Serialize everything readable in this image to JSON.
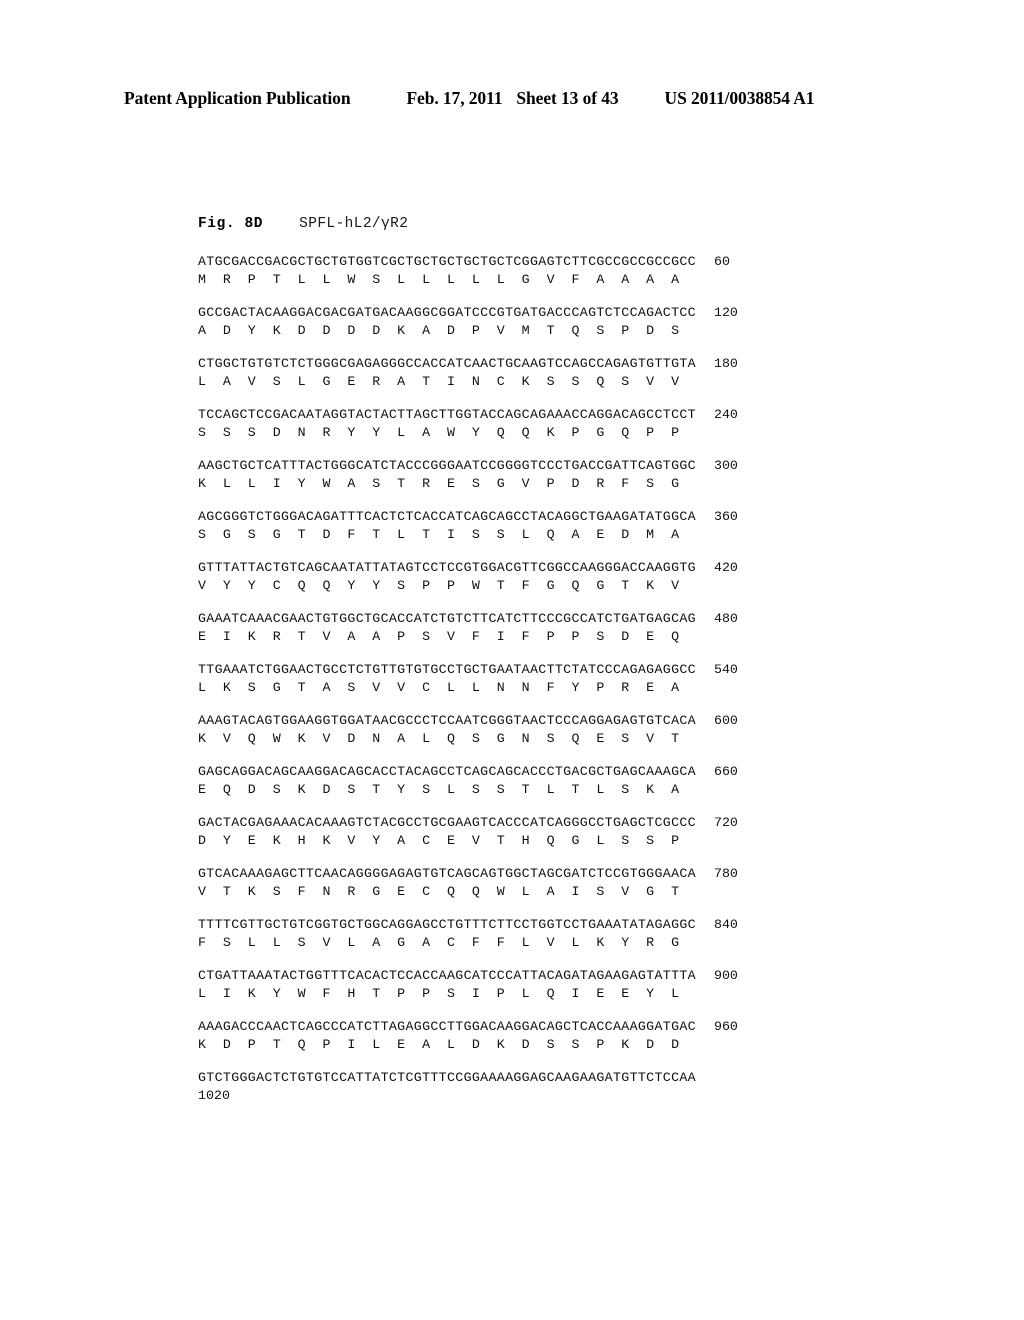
{
  "header": {
    "publication_type": "Patent Application Publication",
    "date": "Feb. 17, 2011",
    "sheet": "Sheet 13 of 43",
    "publication_number": "US 2011/0038854 A1"
  },
  "figure": {
    "label": "Fig. 8D",
    "name": "SPFL-hL2/γR2"
  },
  "sequence": {
    "final_position": "1020",
    "blocks": [
      {
        "nucleotides": "ATGCGACCGACGCTGCTGTGGTCGCTGCTGCTGCTGCTCGGAGTCTTCGCCGCCGCCGCC",
        "end_position": "60",
        "amino_acids": "M  R  P  T  L  L  W  S  L  L  L  L  L  G  V  F  A  A  A  A"
      },
      {
        "nucleotides": "GCCGACTACAAGGACGACGATGACAAGGCGGATCCCGTGATGACCCAGTCTCCAGACTCC",
        "end_position": "120",
        "amino_acids": "A  D  Y  K  D  D  D  D  K  A  D  P  V  M  T  Q  S  P  D  S"
      },
      {
        "nucleotides": "CTGGCTGTGTCTCTGGGCGAGAGGGCCACCATCAACTGCAAGTCCAGCCAGAGTGTTGTA",
        "end_position": "180",
        "amino_acids": "L  A  V  S  L  G  E  R  A  T  I  N  C  K  S  S  Q  S  V  V"
      },
      {
        "nucleotides": "TCCAGCTCCGACAATAGGTACTACTTAGCTTGGTACCAGCAGAAACCAGGACAGCCTCCT",
        "end_position": "240",
        "amino_acids": "S  S  S  D  N  R  Y  Y  L  A  W  Y  Q  Q  K  P  G  Q  P  P"
      },
      {
        "nucleotides": "AAGCTGCTCATTTACTGGGCATCTACCCGGGAATCCGGGGTCCCTGACCGATTCAGTGGC",
        "end_position": "300",
        "amino_acids": "K  L  L  I  Y  W  A  S  T  R  E  S  G  V  P  D  R  F  S  G"
      },
      {
        "nucleotides": "AGCGGGTCTGGGACAGATTTCACTCTCACCATCAGCAGCCTACAGGCTGAAGATATGGCA",
        "end_position": "360",
        "amino_acids": "S  G  S  G  T  D  F  T  L  T  I  S  S  L  Q  A  E  D  M  A"
      },
      {
        "nucleotides": "GTTTATTACTGTCAGCAATATTATAGTCCTCCGTGGACGTTCGGCCAAGGGACCAAGGTG",
        "end_position": "420",
        "amino_acids": "V  Y  Y  C  Q  Q  Y  Y  S  P  P  W  T  F  G  Q  G  T  K  V"
      },
      {
        "nucleotides": "GAAATCAAACGAACTGTGGCTGCACCATCTGTCTTCATCTTCCCGCCATCTGATGAGCAG",
        "end_position": "480",
        "amino_acids": "E  I  K  R  T  V  A  A  P  S  V  F  I  F  P  P  S  D  E  Q"
      },
      {
        "nucleotides": "TTGAAATCTGGAACTGCCTCTGTTGTGTGCCTGCTGAATAACTTCTATCCCAGAGAGGCC",
        "end_position": "540",
        "amino_acids": "L  K  S  G  T  A  S  V  V  C  L  L  N  N  F  Y  P  R  E  A"
      },
      {
        "nucleotides": "AAAGTACAGTGGAAGGTGGATAACGCCCTCCAATCGGGTAACTCCCAGGAGAGTGTCACA",
        "end_position": "600",
        "amino_acids": "K  V  Q  W  K  V  D  N  A  L  Q  S  G  N  S  Q  E  S  V  T"
      },
      {
        "nucleotides": "GAGCAGGACAGCAAGGACAGCACCTACAGCCTCAGCAGCACCCTGACGCTGAGCAAAGCA",
        "end_position": "660",
        "amino_acids": "E  Q  D  S  K  D  S  T  Y  S  L  S  S  T  L  T  L  S  K  A"
      },
      {
        "nucleotides": "GACTACGAGAAACACAAAGTCTACGCCTGCGAAGTCACCCATCAGGGCCTGAGCTCGCCC",
        "end_position": "720",
        "amino_acids": "D  Y  E  K  H  K  V  Y  A  C  E  V  T  H  Q  G  L  S  S  P"
      },
      {
        "nucleotides": "GTCACAAAGAGCTTCAACAGGGGAGAGTGTCAGCAGTGGCTAGCGATCTCCGTGGGAACA",
        "end_position": "780",
        "amino_acids": "V  T  K  S  F  N  R  G  E  C  Q  Q  W  L  A  I  S  V  G  T"
      },
      {
        "nucleotides": "TTTTCGTTGCTGTCGGTGCTGGCAGGAGCCTGTTTCTTCCTGGTCCTGAAATATAGAGGC",
        "end_position": "840",
        "amino_acids": "F  S  L  L  S  V  L  A  G  A  C  F  F  L  V  L  K  Y  R  G"
      },
      {
        "nucleotides": "CTGATTAAATACTGGTTTCACACTCCACCAAGCATCCCATTACAGATAGAAGAGTATTTA",
        "end_position": "900",
        "amino_acids": "L  I  K  Y  W  F  H  T  P  P  S  I  P  L  Q  I  E  E  Y  L"
      },
      {
        "nucleotides": "AAAGACCCAACTCAGCCCATCTTAGAGGCCTTGGACAAGGACAGCTCACCAAAGGATGAC",
        "end_position": "960",
        "amino_acids": "K  D  P  T  Q  P  I  L  E  A  L  D  K  D  S  S  P  K  D  D"
      },
      {
        "nucleotides": "GTCTGGGACTCTGTGTCCATTATCTCGTTTCCGGAAAAGGAGCAAGAAGATGTTCTCCAA",
        "end_position": "",
        "amino_acids": ""
      }
    ]
  }
}
